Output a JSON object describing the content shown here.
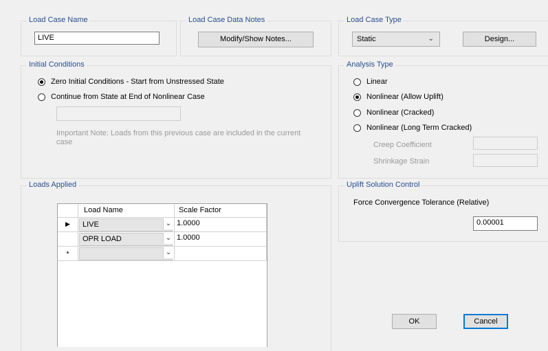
{
  "load_case_name": {
    "title": "Load Case Name",
    "value": "LIVE"
  },
  "notes": {
    "title": "Load Case Data Notes",
    "button_label": "Modify/Show Notes..."
  },
  "load_case_type": {
    "title": "Load Case Type",
    "selected": "Static",
    "design_button": "Design..."
  },
  "initial_conditions": {
    "title": "Initial Conditions",
    "option_zero": "Zero Initial Conditions - Start from Unstressed State",
    "option_continue": "Continue from State at End of Nonlinear Case",
    "continue_case_value": "",
    "note": "Important Note:  Loads from this previous case are included in the current case"
  },
  "analysis_type": {
    "title": "Analysis Type",
    "options": [
      "Linear",
      "Nonlinear (Allow Uplift)",
      "Nonlinear (Cracked)",
      "Nonlinear (Long Term Cracked)"
    ],
    "selected_index": 1,
    "creep_label": "Creep Coefficient",
    "shrinkage_label": "Shrinkage Strain"
  },
  "loads_applied": {
    "title": "Loads Applied",
    "columns": [
      "Load Name",
      "Scale Factor"
    ],
    "rows": [
      {
        "marker": "▶",
        "name": "LIVE",
        "scale": "1.0000"
      },
      {
        "marker": "",
        "name": "OPR LOAD",
        "scale": "1.0000"
      },
      {
        "marker": "*",
        "name": "",
        "scale": ""
      }
    ]
  },
  "uplift": {
    "title": "Uplift Solution Control",
    "tolerance_label": "Force Convergence Tolerance (Relative)",
    "tolerance_value": "0.00001"
  },
  "buttons": {
    "ok": "OK",
    "cancel": "Cancel"
  }
}
